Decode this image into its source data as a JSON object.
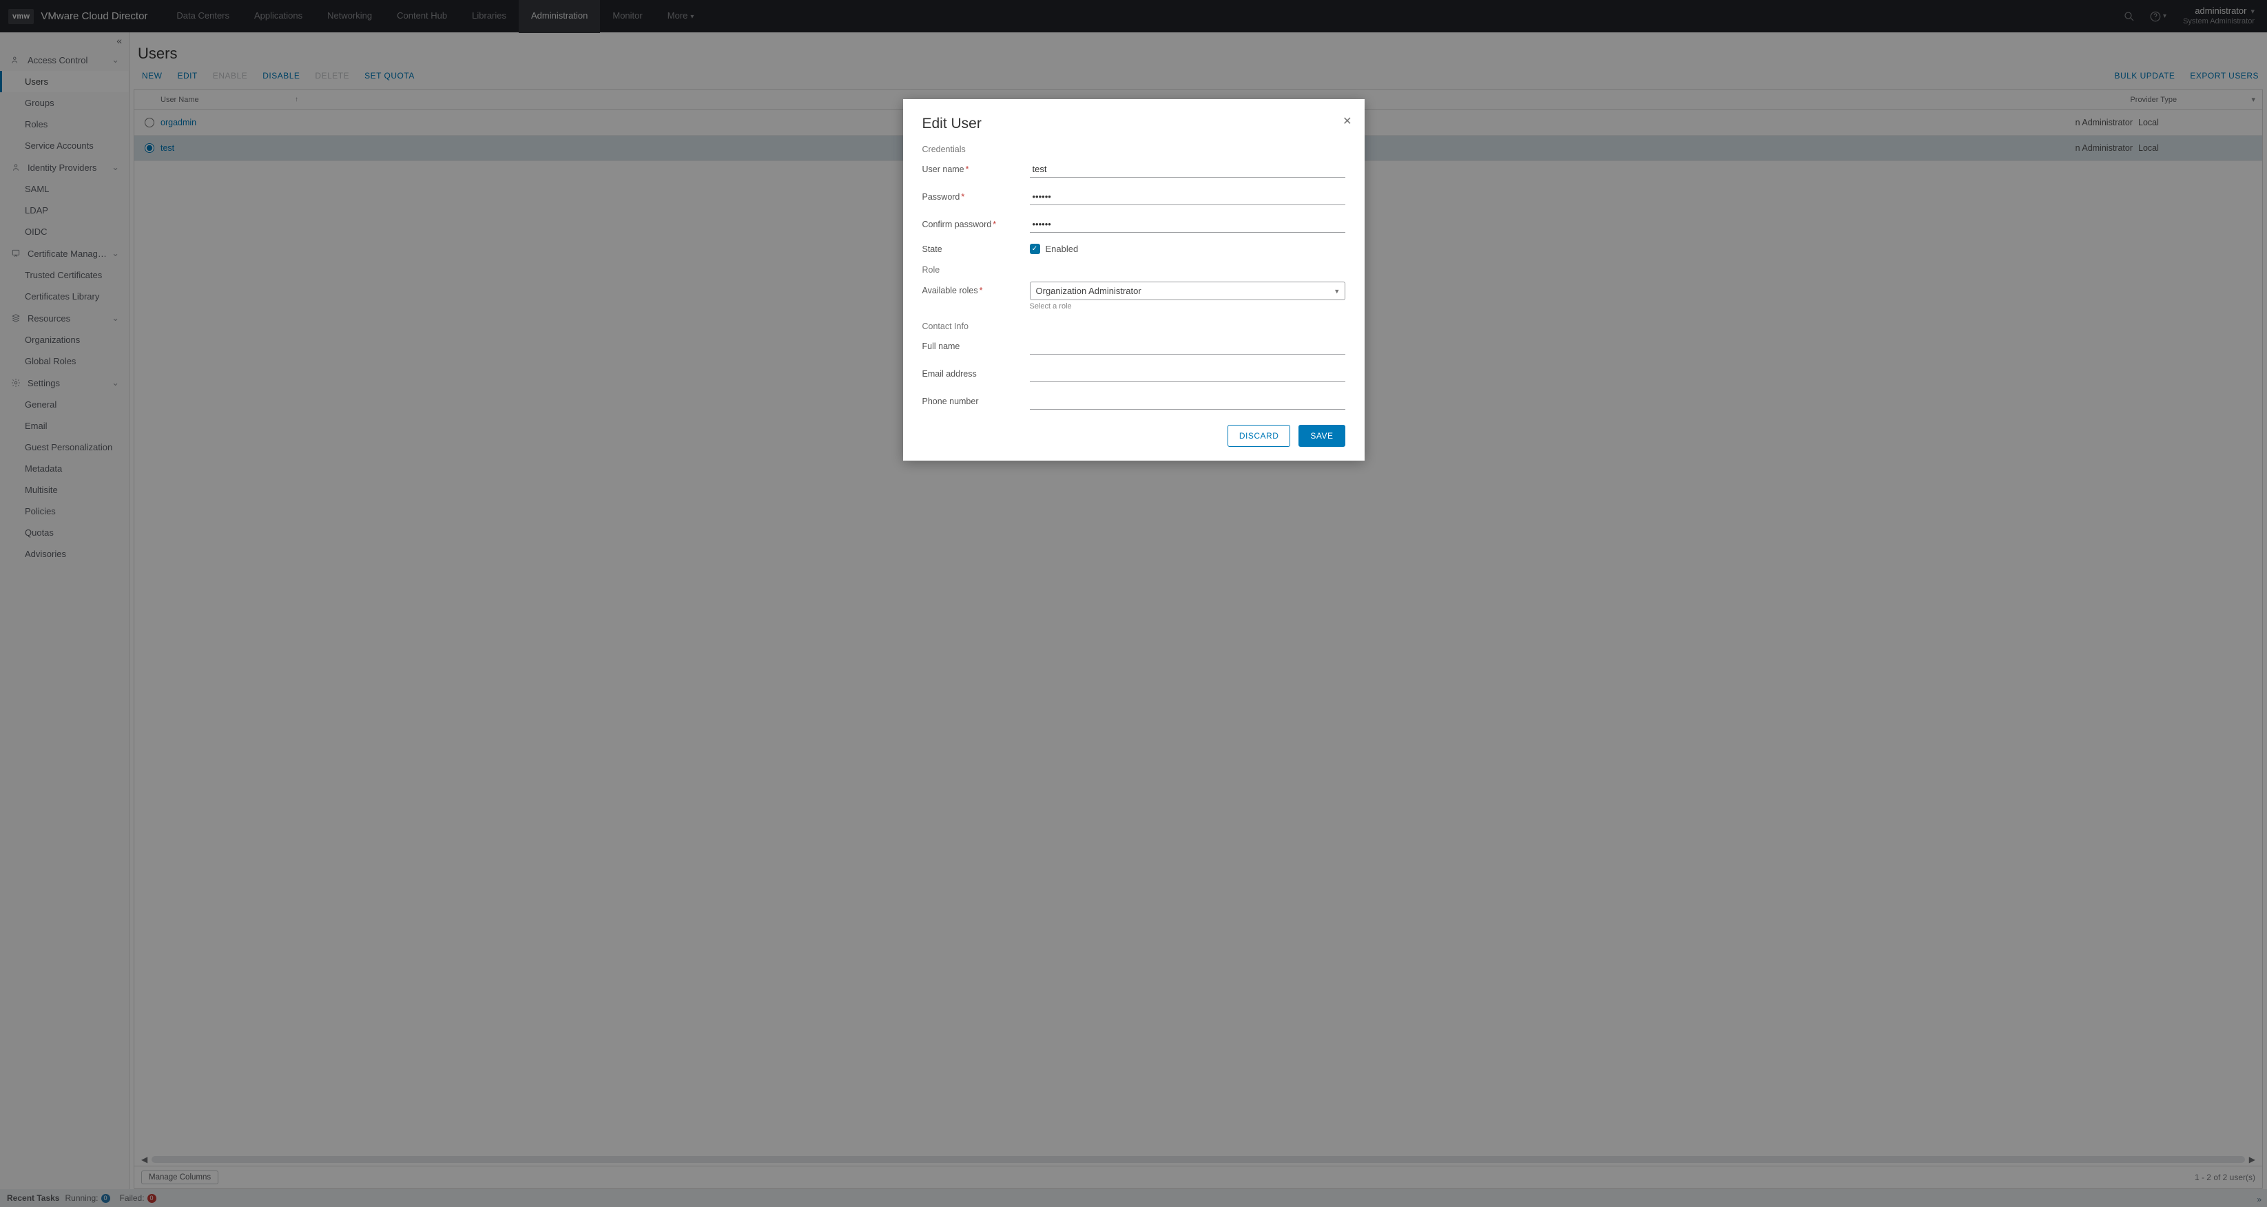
{
  "header": {
    "logo": "vmw",
    "product": "VMware Cloud Director",
    "nav": [
      "Data Centers",
      "Applications",
      "Networking",
      "Content Hub",
      "Libraries",
      "Administration",
      "Monitor"
    ],
    "nav_active_index": 5,
    "more_label": "More",
    "user": "administrator",
    "role": "System Administrator"
  },
  "sidebar": {
    "sections": [
      {
        "label": "Access Control",
        "items": [
          "Users",
          "Groups",
          "Roles",
          "Service Accounts"
        ],
        "active_item_index": 0
      },
      {
        "label": "Identity Providers",
        "items": [
          "SAML",
          "LDAP",
          "OIDC"
        ]
      },
      {
        "label": "Certificate Managem…",
        "items": [
          "Trusted Certificates",
          "Certificates Library"
        ]
      },
      {
        "label": "Resources",
        "items": [
          "Organizations",
          "Global Roles"
        ]
      },
      {
        "label": "Settings",
        "items": [
          "General",
          "Email",
          "Guest Personalization",
          "Metadata",
          "Multisite",
          "Policies",
          "Quotas",
          "Advisories"
        ]
      }
    ]
  },
  "page": {
    "title": "Users",
    "actions": {
      "new": "NEW",
      "edit": "EDIT",
      "enable": "ENABLE",
      "disable": "DISABLE",
      "delete": "DELETE",
      "set_quota": "SET QUOTA",
      "bulk_update": "BULK UPDATE",
      "export": "EXPORT USERS"
    },
    "grid": {
      "columns": {
        "user_name": "User Name",
        "provider": "Provider Type"
      },
      "rows": [
        {
          "name": "orgadmin",
          "role_suffix": "n Administrator",
          "provider": "Local",
          "selected": false
        },
        {
          "name": "test",
          "role_suffix": "n Administrator",
          "provider": "Local",
          "selected": true
        }
      ],
      "manage_cols": "Manage Columns",
      "pager": "1 - 2 of 2 user(s)"
    }
  },
  "modal": {
    "title": "Edit User",
    "sections": {
      "credentials": "Credentials",
      "role": "Role",
      "contact": "Contact Info"
    },
    "labels": {
      "username": "User name",
      "password": "Password",
      "confirm": "Confirm password",
      "state": "State",
      "enabled": "Enabled",
      "available_roles": "Available roles",
      "select_helper": "Select a role",
      "full_name": "Full name",
      "email": "Email address",
      "phone": "Phone number"
    },
    "values": {
      "username": "test",
      "password": "••••••",
      "confirm": "••••••",
      "role": "Organization Administrator",
      "full_name": "",
      "email": "",
      "phone": ""
    },
    "buttons": {
      "discard": "DISCARD",
      "save": "SAVE"
    }
  },
  "footer": {
    "recent": "Recent Tasks",
    "running": "Running:",
    "running_n": "0",
    "failed": "Failed:",
    "failed_n": "0"
  }
}
